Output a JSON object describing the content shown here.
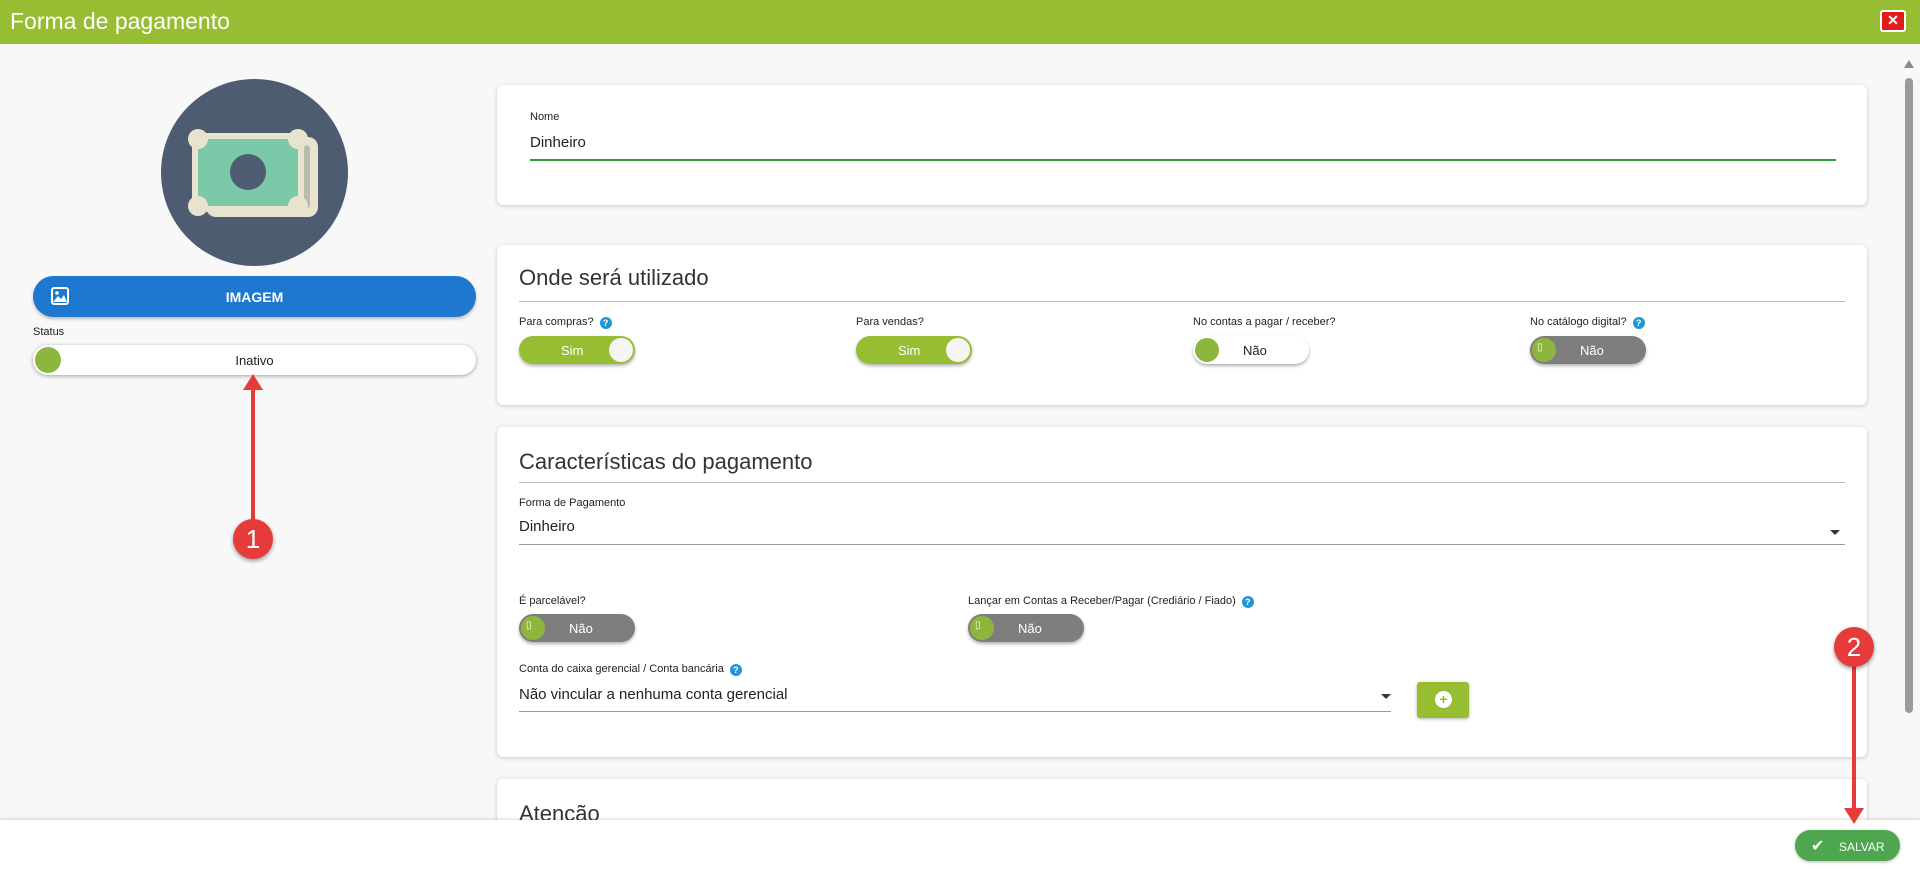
{
  "window": {
    "title": "Forma de pagamento",
    "close_icon": "close-icon"
  },
  "sidebar": {
    "avatar_icon": "money-bill-icon",
    "image_button": {
      "label": "IMAGEM",
      "icon": "image-icon"
    },
    "status": {
      "label": "Status",
      "value": "Inativo"
    }
  },
  "name_card": {
    "label": "Nome",
    "value": "Dinheiro"
  },
  "usage_card": {
    "title": "Onde será utilizado",
    "toggles": [
      {
        "label": "Para compras?",
        "value": "Sim",
        "help": "?"
      },
      {
        "label": "Para vendas?",
        "value": "Sim"
      },
      {
        "label": "No contas a pagar / receber?",
        "value": "Não"
      },
      {
        "label": "No catálogo digital?",
        "value": "Não",
        "help": "?"
      }
    ]
  },
  "payment_card": {
    "title": "Características do pagamento",
    "method": {
      "label": "Forma de Pagamento",
      "value": "Dinheiro"
    },
    "installment": {
      "label": "É parcelável?",
      "value": "Não"
    },
    "accounts": {
      "label": "Lançar em Contas a Receber/Pagar (Crediário / Fiado)",
      "value": "Não",
      "help": "?"
    },
    "bank_account": {
      "label": "Conta do caixa gerencial / Conta bancária",
      "value": "Não vincular a nenhuma conta gerencial",
      "help": "?"
    },
    "add_button_icon": "plus-circle-icon"
  },
  "attention_card": {
    "title": "Atenção"
  },
  "footer": {
    "save_label": "SALVAR"
  },
  "annotations": {
    "marker_1": "1",
    "marker_2": "2",
    "color": "#e63b3b"
  },
  "colors": {
    "header": "#97bd33",
    "primary_button": "#1e78cf",
    "save_button": "#4ea64e",
    "toggle_off": "#7e7e7e"
  }
}
